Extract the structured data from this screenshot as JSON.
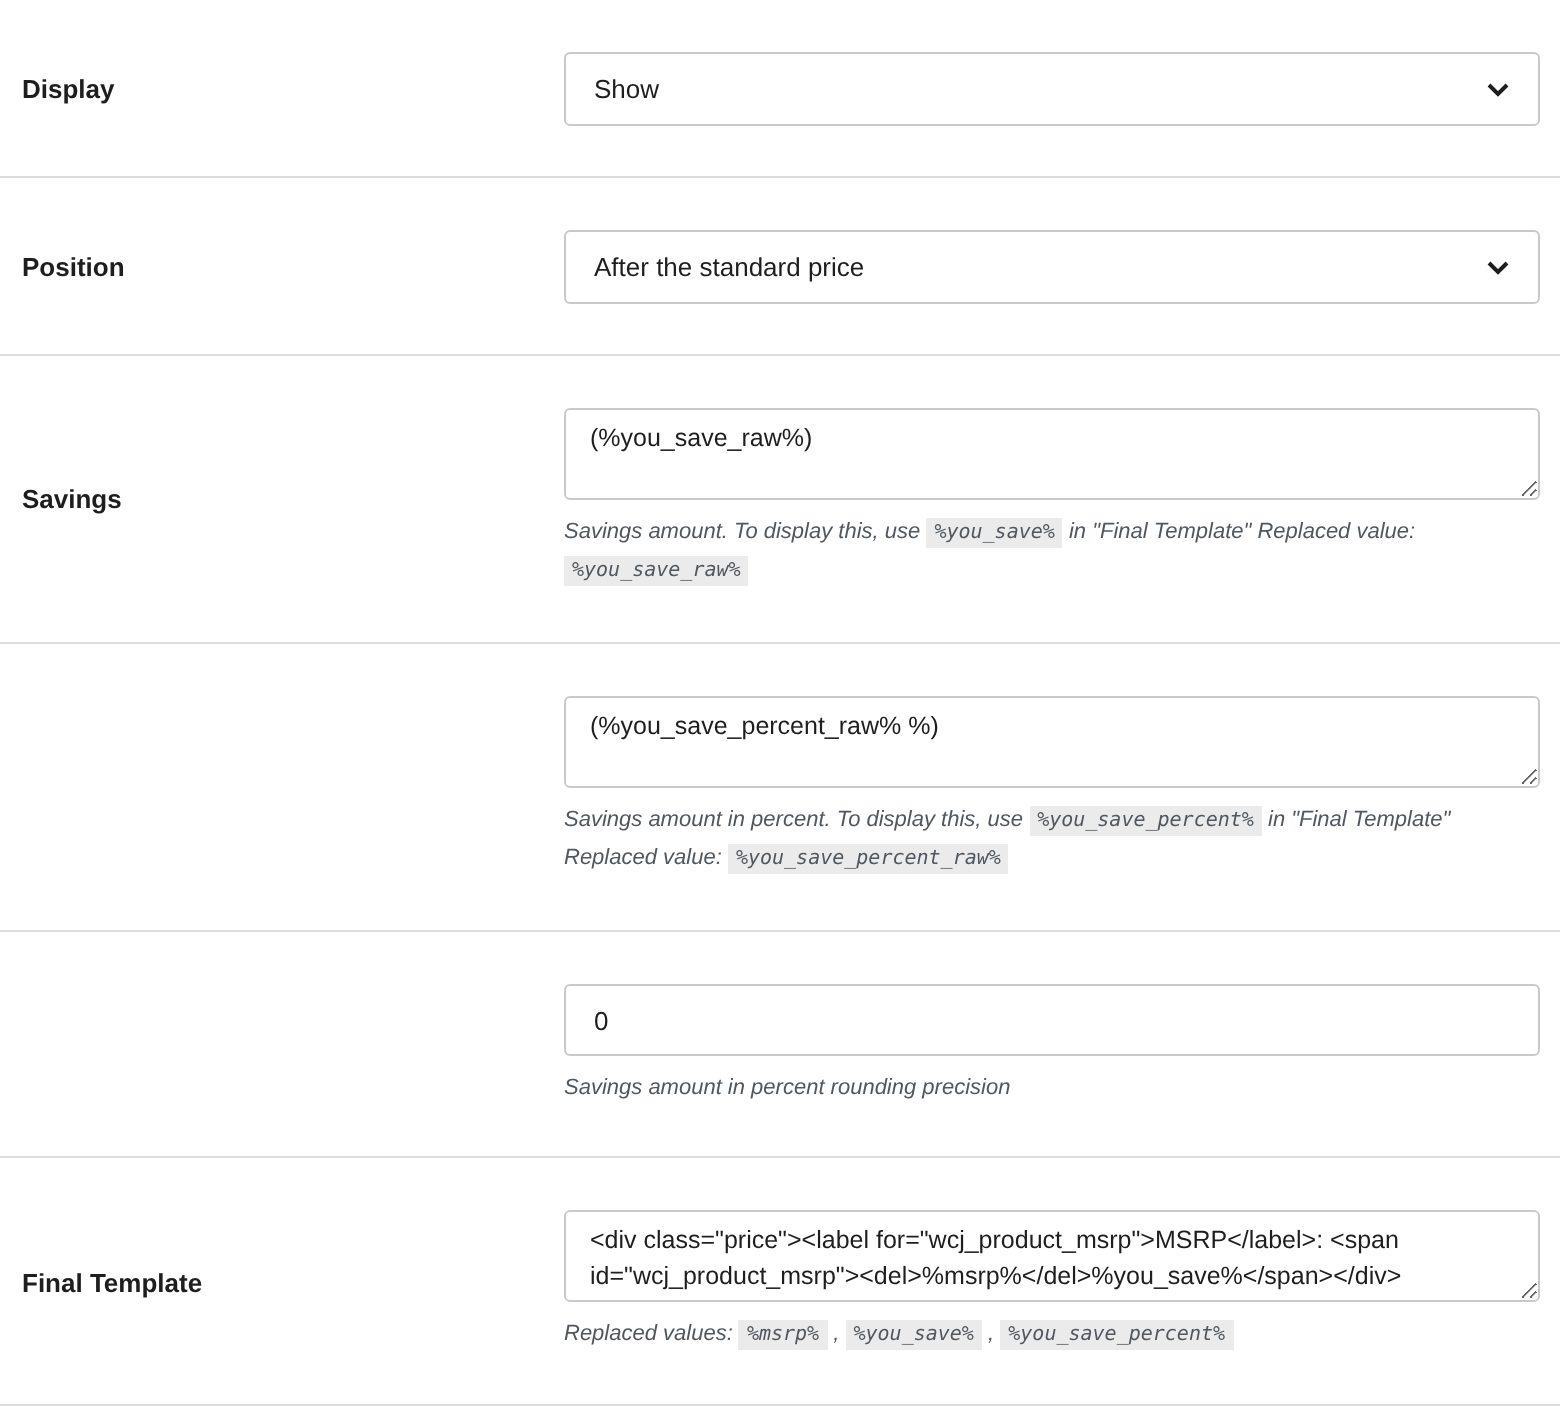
{
  "rows": [
    {
      "label": "Display",
      "control": {
        "kind": "select",
        "value": "Show"
      },
      "description": []
    },
    {
      "label": "Position",
      "control": {
        "kind": "select",
        "value": "After the standard price"
      },
      "description": []
    },
    {
      "label": "Savings",
      "control": {
        "kind": "textarea",
        "value": "(%you_save_raw%)"
      },
      "description": [
        {
          "kind": "text",
          "text": "Savings amount. To display this, use "
        },
        {
          "kind": "code",
          "text": "%you_save%"
        },
        {
          "kind": "text",
          "text": " in \"Final Template\" Replaced value: "
        },
        {
          "kind": "code",
          "text": "%you_save_raw%"
        }
      ]
    },
    {
      "label": "",
      "control": {
        "kind": "textarea",
        "value": "(%you_save_percent_raw% %)"
      },
      "description": [
        {
          "kind": "text",
          "text": "Savings amount in percent. To display this, use "
        },
        {
          "kind": "code",
          "text": "%you_save_percent%"
        },
        {
          "kind": "text",
          "text": " in \"Final Template\" Replaced value: "
        },
        {
          "kind": "code",
          "text": "%you_save_percent_raw%"
        }
      ]
    },
    {
      "label": "",
      "control": {
        "kind": "input",
        "value": "0"
      },
      "description": [
        {
          "kind": "text",
          "text": "Savings amount in percent rounding precision"
        }
      ]
    },
    {
      "label": "Final Template",
      "control": {
        "kind": "textarea",
        "value": "<div class=\"price\"><label for=\"wcj_product_msrp\">MSRP</label>: <span id=\"wcj_product_msrp\"><del>%msrp%</del>%you_save%</span></div>"
      },
      "description": [
        {
          "kind": "text",
          "text": "Replaced values: "
        },
        {
          "kind": "code",
          "text": "%msrp%"
        },
        {
          "kind": "text",
          "text": " , "
        },
        {
          "kind": "code",
          "text": "%you_save%"
        },
        {
          "kind": "text",
          "text": " , "
        },
        {
          "kind": "code",
          "text": "%you_save_percent%"
        }
      ]
    }
  ]
}
